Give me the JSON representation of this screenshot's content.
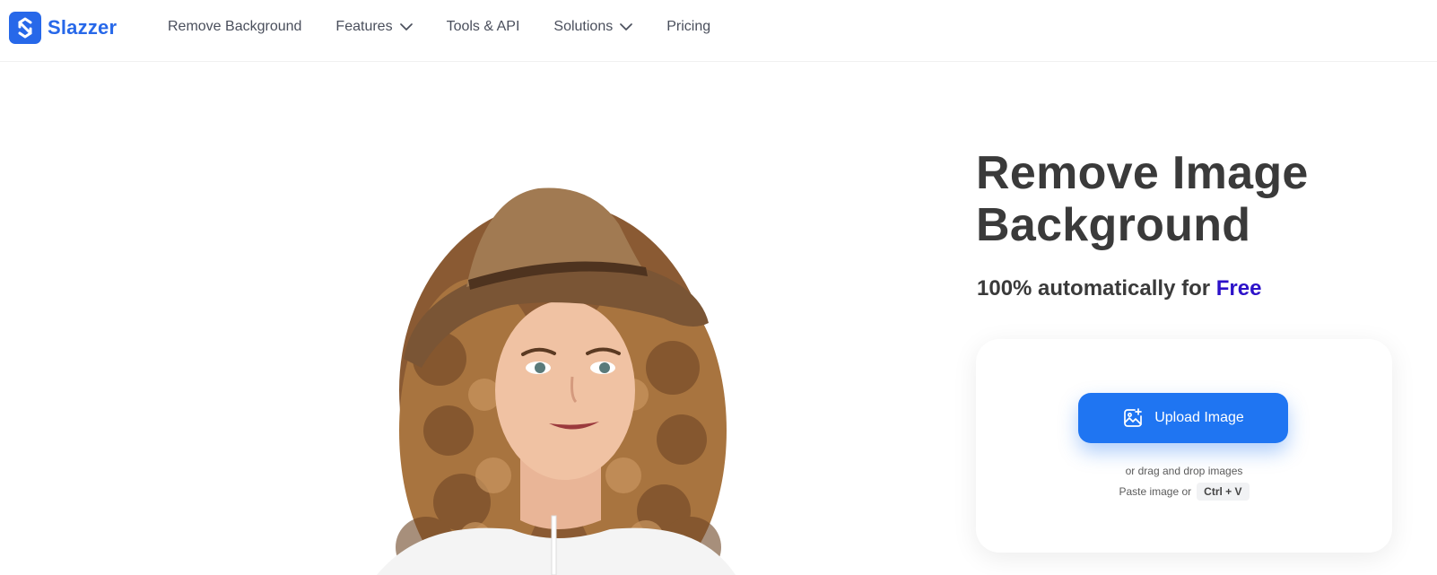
{
  "brand": {
    "name": "Slazzer",
    "color": "#2768e9"
  },
  "nav": {
    "items": [
      {
        "label": "Remove Background",
        "has_dropdown": false
      },
      {
        "label": "Features",
        "has_dropdown": true
      },
      {
        "label": "Tools & API",
        "has_dropdown": false
      },
      {
        "label": "Solutions",
        "has_dropdown": true
      },
      {
        "label": "Pricing",
        "has_dropdown": false
      }
    ]
  },
  "hero": {
    "title_line1": "Remove Image",
    "title_line2": "Background",
    "subtitle_prefix": "100% automatically for ",
    "subtitle_accent": "Free",
    "accent_color": "#2d12c9"
  },
  "upload": {
    "button_label": "Upload Image",
    "button_icon": "image-plus-icon",
    "drag_text": "or drag and drop images",
    "paste_text": "Paste image or",
    "shortcut": "Ctrl + V",
    "button_color": "#1f75f2"
  },
  "image": {
    "icon": "woman-with-hat-photo"
  }
}
